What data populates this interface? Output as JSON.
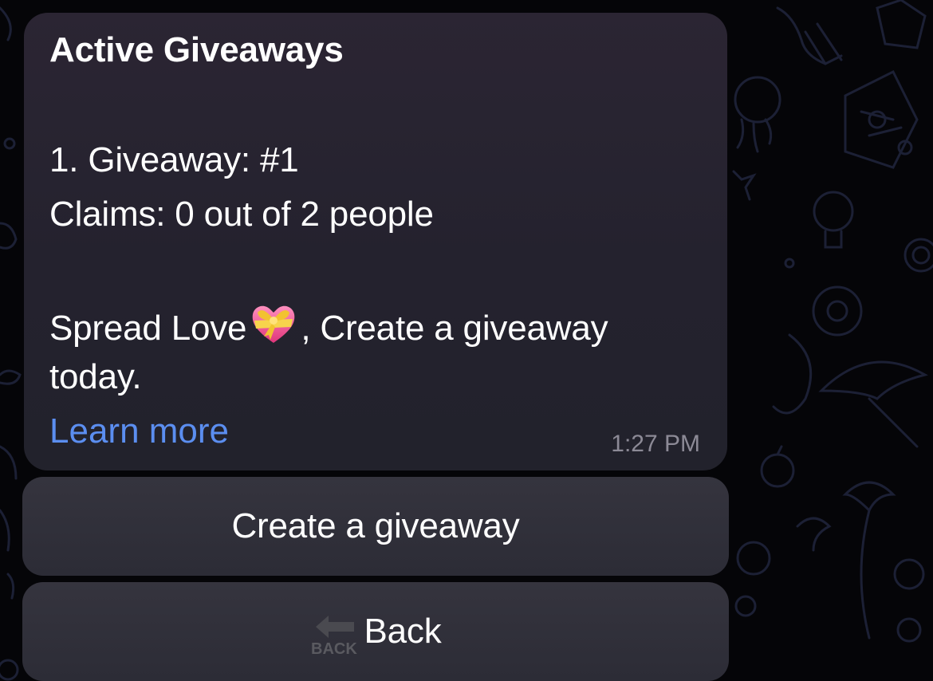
{
  "message": {
    "title": "Active Giveaways",
    "line1": "1. Giveaway: #1",
    "line2": "Claims: 0 out of 2 people",
    "spread_text_before": "Spread Love",
    "spread_emoji": "heart-with-ribbon",
    "spread_text_after": ", Create a giveaway",
    "spread_text_line2": "today.",
    "link_label": "Learn more",
    "time": "1:27 PM"
  },
  "keyboard": {
    "create_label": "Create a giveaway",
    "back_label": "Back",
    "back_icon": "back-arrow-icon",
    "back_icon_text": "BACK"
  },
  "colors": {
    "bubble": "#26232f",
    "button": "#31303a",
    "link": "#5b8ef0",
    "timestamp": "#8c8a96",
    "background": "#050508"
  }
}
